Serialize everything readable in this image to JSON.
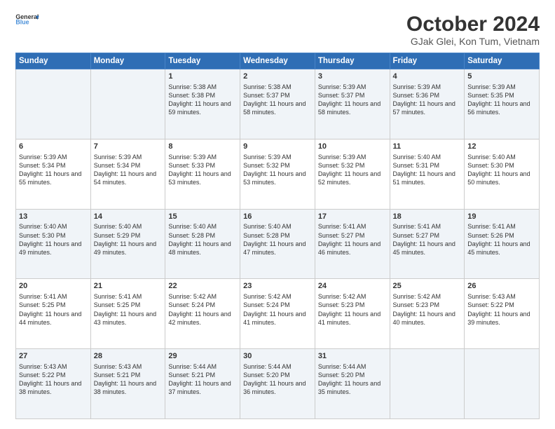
{
  "header": {
    "logo_line1": "General",
    "logo_line2": "Blue",
    "month_title": "October 2024",
    "location": "GJak Glei, Kon Tum, Vietnam"
  },
  "days_of_week": [
    "Sunday",
    "Monday",
    "Tuesday",
    "Wednesday",
    "Thursday",
    "Friday",
    "Saturday"
  ],
  "weeks": [
    [
      {
        "day": "",
        "sunrise": "",
        "sunset": "",
        "daylight": ""
      },
      {
        "day": "",
        "sunrise": "",
        "sunset": "",
        "daylight": ""
      },
      {
        "day": "1",
        "sunrise": "Sunrise: 5:38 AM",
        "sunset": "Sunset: 5:38 PM",
        "daylight": "Daylight: 11 hours and 59 minutes."
      },
      {
        "day": "2",
        "sunrise": "Sunrise: 5:38 AM",
        "sunset": "Sunset: 5:37 PM",
        "daylight": "Daylight: 11 hours and 58 minutes."
      },
      {
        "day": "3",
        "sunrise": "Sunrise: 5:39 AM",
        "sunset": "Sunset: 5:37 PM",
        "daylight": "Daylight: 11 hours and 58 minutes."
      },
      {
        "day": "4",
        "sunrise": "Sunrise: 5:39 AM",
        "sunset": "Sunset: 5:36 PM",
        "daylight": "Daylight: 11 hours and 57 minutes."
      },
      {
        "day": "5",
        "sunrise": "Sunrise: 5:39 AM",
        "sunset": "Sunset: 5:35 PM",
        "daylight": "Daylight: 11 hours and 56 minutes."
      }
    ],
    [
      {
        "day": "6",
        "sunrise": "Sunrise: 5:39 AM",
        "sunset": "Sunset: 5:34 PM",
        "daylight": "Daylight: 11 hours and 55 minutes."
      },
      {
        "day": "7",
        "sunrise": "Sunrise: 5:39 AM",
        "sunset": "Sunset: 5:34 PM",
        "daylight": "Daylight: 11 hours and 54 minutes."
      },
      {
        "day": "8",
        "sunrise": "Sunrise: 5:39 AM",
        "sunset": "Sunset: 5:33 PM",
        "daylight": "Daylight: 11 hours and 53 minutes."
      },
      {
        "day": "9",
        "sunrise": "Sunrise: 5:39 AM",
        "sunset": "Sunset: 5:32 PM",
        "daylight": "Daylight: 11 hours and 53 minutes."
      },
      {
        "day": "10",
        "sunrise": "Sunrise: 5:39 AM",
        "sunset": "Sunset: 5:32 PM",
        "daylight": "Daylight: 11 hours and 52 minutes."
      },
      {
        "day": "11",
        "sunrise": "Sunrise: 5:40 AM",
        "sunset": "Sunset: 5:31 PM",
        "daylight": "Daylight: 11 hours and 51 minutes."
      },
      {
        "day": "12",
        "sunrise": "Sunrise: 5:40 AM",
        "sunset": "Sunset: 5:30 PM",
        "daylight": "Daylight: 11 hours and 50 minutes."
      }
    ],
    [
      {
        "day": "13",
        "sunrise": "Sunrise: 5:40 AM",
        "sunset": "Sunset: 5:30 PM",
        "daylight": "Daylight: 11 hours and 49 minutes."
      },
      {
        "day": "14",
        "sunrise": "Sunrise: 5:40 AM",
        "sunset": "Sunset: 5:29 PM",
        "daylight": "Daylight: 11 hours and 49 minutes."
      },
      {
        "day": "15",
        "sunrise": "Sunrise: 5:40 AM",
        "sunset": "Sunset: 5:28 PM",
        "daylight": "Daylight: 11 hours and 48 minutes."
      },
      {
        "day": "16",
        "sunrise": "Sunrise: 5:40 AM",
        "sunset": "Sunset: 5:28 PM",
        "daylight": "Daylight: 11 hours and 47 minutes."
      },
      {
        "day": "17",
        "sunrise": "Sunrise: 5:41 AM",
        "sunset": "Sunset: 5:27 PM",
        "daylight": "Daylight: 11 hours and 46 minutes."
      },
      {
        "day": "18",
        "sunrise": "Sunrise: 5:41 AM",
        "sunset": "Sunset: 5:27 PM",
        "daylight": "Daylight: 11 hours and 45 minutes."
      },
      {
        "day": "19",
        "sunrise": "Sunrise: 5:41 AM",
        "sunset": "Sunset: 5:26 PM",
        "daylight": "Daylight: 11 hours and 45 minutes."
      }
    ],
    [
      {
        "day": "20",
        "sunrise": "Sunrise: 5:41 AM",
        "sunset": "Sunset: 5:25 PM",
        "daylight": "Daylight: 11 hours and 44 minutes."
      },
      {
        "day": "21",
        "sunrise": "Sunrise: 5:41 AM",
        "sunset": "Sunset: 5:25 PM",
        "daylight": "Daylight: 11 hours and 43 minutes."
      },
      {
        "day": "22",
        "sunrise": "Sunrise: 5:42 AM",
        "sunset": "Sunset: 5:24 PM",
        "daylight": "Daylight: 11 hours and 42 minutes."
      },
      {
        "day": "23",
        "sunrise": "Sunrise: 5:42 AM",
        "sunset": "Sunset: 5:24 PM",
        "daylight": "Daylight: 11 hours and 41 minutes."
      },
      {
        "day": "24",
        "sunrise": "Sunrise: 5:42 AM",
        "sunset": "Sunset: 5:23 PM",
        "daylight": "Daylight: 11 hours and 41 minutes."
      },
      {
        "day": "25",
        "sunrise": "Sunrise: 5:42 AM",
        "sunset": "Sunset: 5:23 PM",
        "daylight": "Daylight: 11 hours and 40 minutes."
      },
      {
        "day": "26",
        "sunrise": "Sunrise: 5:43 AM",
        "sunset": "Sunset: 5:22 PM",
        "daylight": "Daylight: 11 hours and 39 minutes."
      }
    ],
    [
      {
        "day": "27",
        "sunrise": "Sunrise: 5:43 AM",
        "sunset": "Sunset: 5:22 PM",
        "daylight": "Daylight: 11 hours and 38 minutes."
      },
      {
        "day": "28",
        "sunrise": "Sunrise: 5:43 AM",
        "sunset": "Sunset: 5:21 PM",
        "daylight": "Daylight: 11 hours and 38 minutes."
      },
      {
        "day": "29",
        "sunrise": "Sunrise: 5:44 AM",
        "sunset": "Sunset: 5:21 PM",
        "daylight": "Daylight: 11 hours and 37 minutes."
      },
      {
        "day": "30",
        "sunrise": "Sunrise: 5:44 AM",
        "sunset": "Sunset: 5:20 PM",
        "daylight": "Daylight: 11 hours and 36 minutes."
      },
      {
        "day": "31",
        "sunrise": "Sunrise: 5:44 AM",
        "sunset": "Sunset: 5:20 PM",
        "daylight": "Daylight: 11 hours and 35 minutes."
      },
      {
        "day": "",
        "sunrise": "",
        "sunset": "",
        "daylight": ""
      },
      {
        "day": "",
        "sunrise": "",
        "sunset": "",
        "daylight": ""
      }
    ]
  ]
}
